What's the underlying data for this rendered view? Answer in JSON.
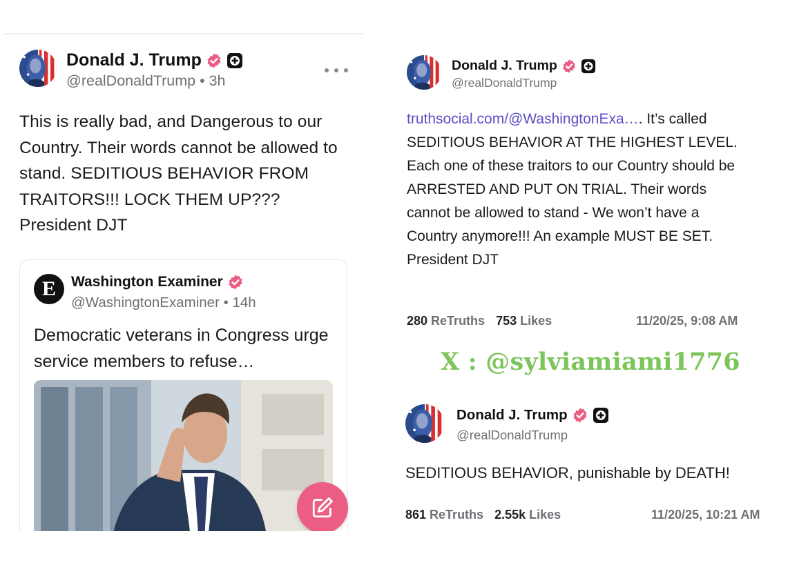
{
  "left_post": {
    "author_name": "Donald J. Trump",
    "handle_time": "@realDonaldTrump • 3h",
    "body": "This is really bad, and Dangerous to our Country. Their words cannot be allowed to stand. SEDITIOUS BEHAVIOR FROM TRAITORS!!! LOCK THEM UP??? President DJT",
    "quoted": {
      "avatar_letter": "E",
      "author_name": "Washington Examiner",
      "handle_time": "@WashingtonExaminer • 14h",
      "body": "Democratic veterans in Congress urge service members to refuse…"
    }
  },
  "right_post_1": {
    "author_name": "Donald J. Trump",
    "handle": "@realDonaldTrump",
    "link_text": "truthsocial.com/@WashingtonExa…",
    "body": ". It’s called SEDITIOUS BEHAVIOR AT THE HIGHEST LEVEL. Each one of these traitors to our Country should be ARRESTED AND PUT ON TRIAL. Their words cannot be allowed to stand - We won’t have a Country anymore!!! An example MUST BE SET. President DJT",
    "retruths_count": "280",
    "retruths_label": "ReTruths",
    "likes_count": "753",
    "likes_label": "Likes",
    "timestamp": "11/20/25, 9:08 AM"
  },
  "watermark": "X : @sylviamiami1776",
  "right_post_2": {
    "author_name": "Donald J. Trump",
    "handle": "@realDonaldTrump",
    "body": "SEDITIOUS BEHAVIOR, punishable by DEATH!",
    "retruths_count": "861",
    "retruths_label": "ReTruths",
    "likes_count": "2.55k",
    "likes_label": "Likes",
    "timestamp": "11/20/25, 10:21 AM"
  },
  "icons": {
    "verified": "verified-badge-icon",
    "plus": "plus-badge-icon",
    "more": "more-options-icon",
    "compose": "compose-icon"
  },
  "colors": {
    "verified_pink": "#ec5d83",
    "link_purple": "#5b4fc7",
    "watermark_green": "#7cc55a",
    "muted_gray": "#6f6f75"
  }
}
